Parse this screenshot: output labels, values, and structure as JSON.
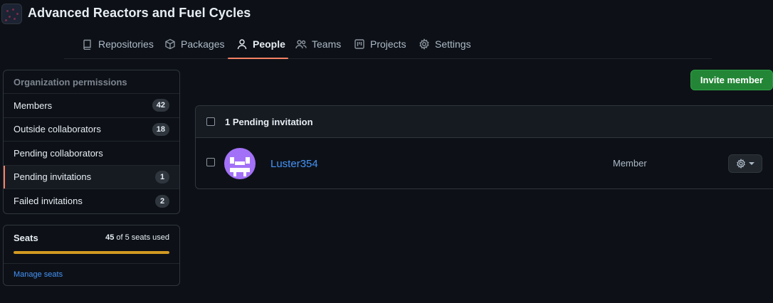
{
  "org": {
    "title": "Advanced Reactors and Fuel Cycles",
    "avatar_icon": "org-avatar-icon"
  },
  "nav": {
    "items": [
      {
        "label": "Repositories",
        "icon": "repo-icon"
      },
      {
        "label": "Packages",
        "icon": "package-icon"
      },
      {
        "label": "People",
        "icon": "person-icon",
        "active": true
      },
      {
        "label": "Teams",
        "icon": "people-icon"
      },
      {
        "label": "Projects",
        "icon": "project-icon"
      },
      {
        "label": "Settings",
        "icon": "gear-icon"
      }
    ]
  },
  "sidebar": {
    "header": "Organization permissions",
    "items": [
      {
        "label": "Members",
        "count": "42"
      },
      {
        "label": "Outside collaborators",
        "count": "18"
      },
      {
        "label": "Pending collaborators",
        "count": ""
      },
      {
        "label": "Pending invitations",
        "count": "1",
        "selected": true
      },
      {
        "label": "Failed invitations",
        "count": "2"
      }
    ],
    "seats": {
      "title": "Seats",
      "used": "45",
      "used_suffix": "of 5 seats used",
      "fill_fraction": 1.0,
      "manage_label": "Manage seats"
    }
  },
  "main": {
    "invite_label": "Invite member",
    "list_header": "1 Pending invitation",
    "rows": [
      {
        "username": "Luster354",
        "role": "Member"
      }
    ]
  },
  "colors": {
    "background": "#0d1117",
    "accent_underline": "#f78166",
    "primary_button": "#238636",
    "link": "#4493f8",
    "seats_bar": "#d29922",
    "avatar": "#a371f7"
  }
}
